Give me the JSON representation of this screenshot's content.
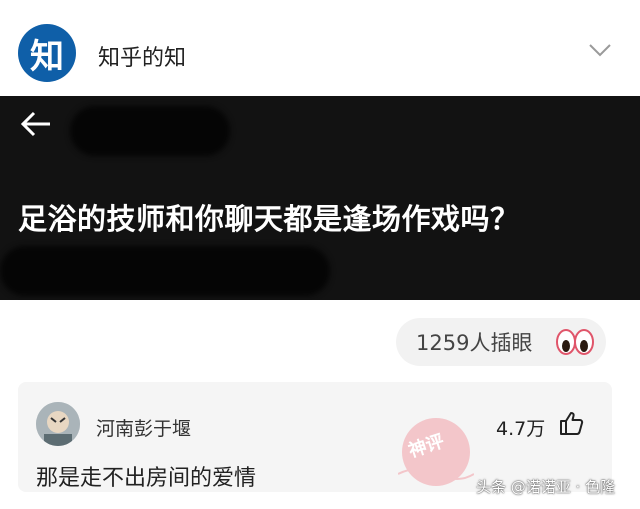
{
  "header": {
    "logo_char": "知",
    "account_name": "知乎的知"
  },
  "banner": {
    "question": "足浴的技师和你聊天都是逢场作戏吗？"
  },
  "stats": {
    "text": "1259人插眼"
  },
  "comment": {
    "user": "河南彭于堰",
    "likes": "4.7万",
    "text": "那是走不出房间的爱情",
    "stamp": "神评"
  },
  "watermark": "头条 @诺诺亚 · 色隆",
  "colors": {
    "logo_blue": "#0f5fa8",
    "banner_bg": "#121212",
    "stamp_pink": "#f2a0a8"
  }
}
